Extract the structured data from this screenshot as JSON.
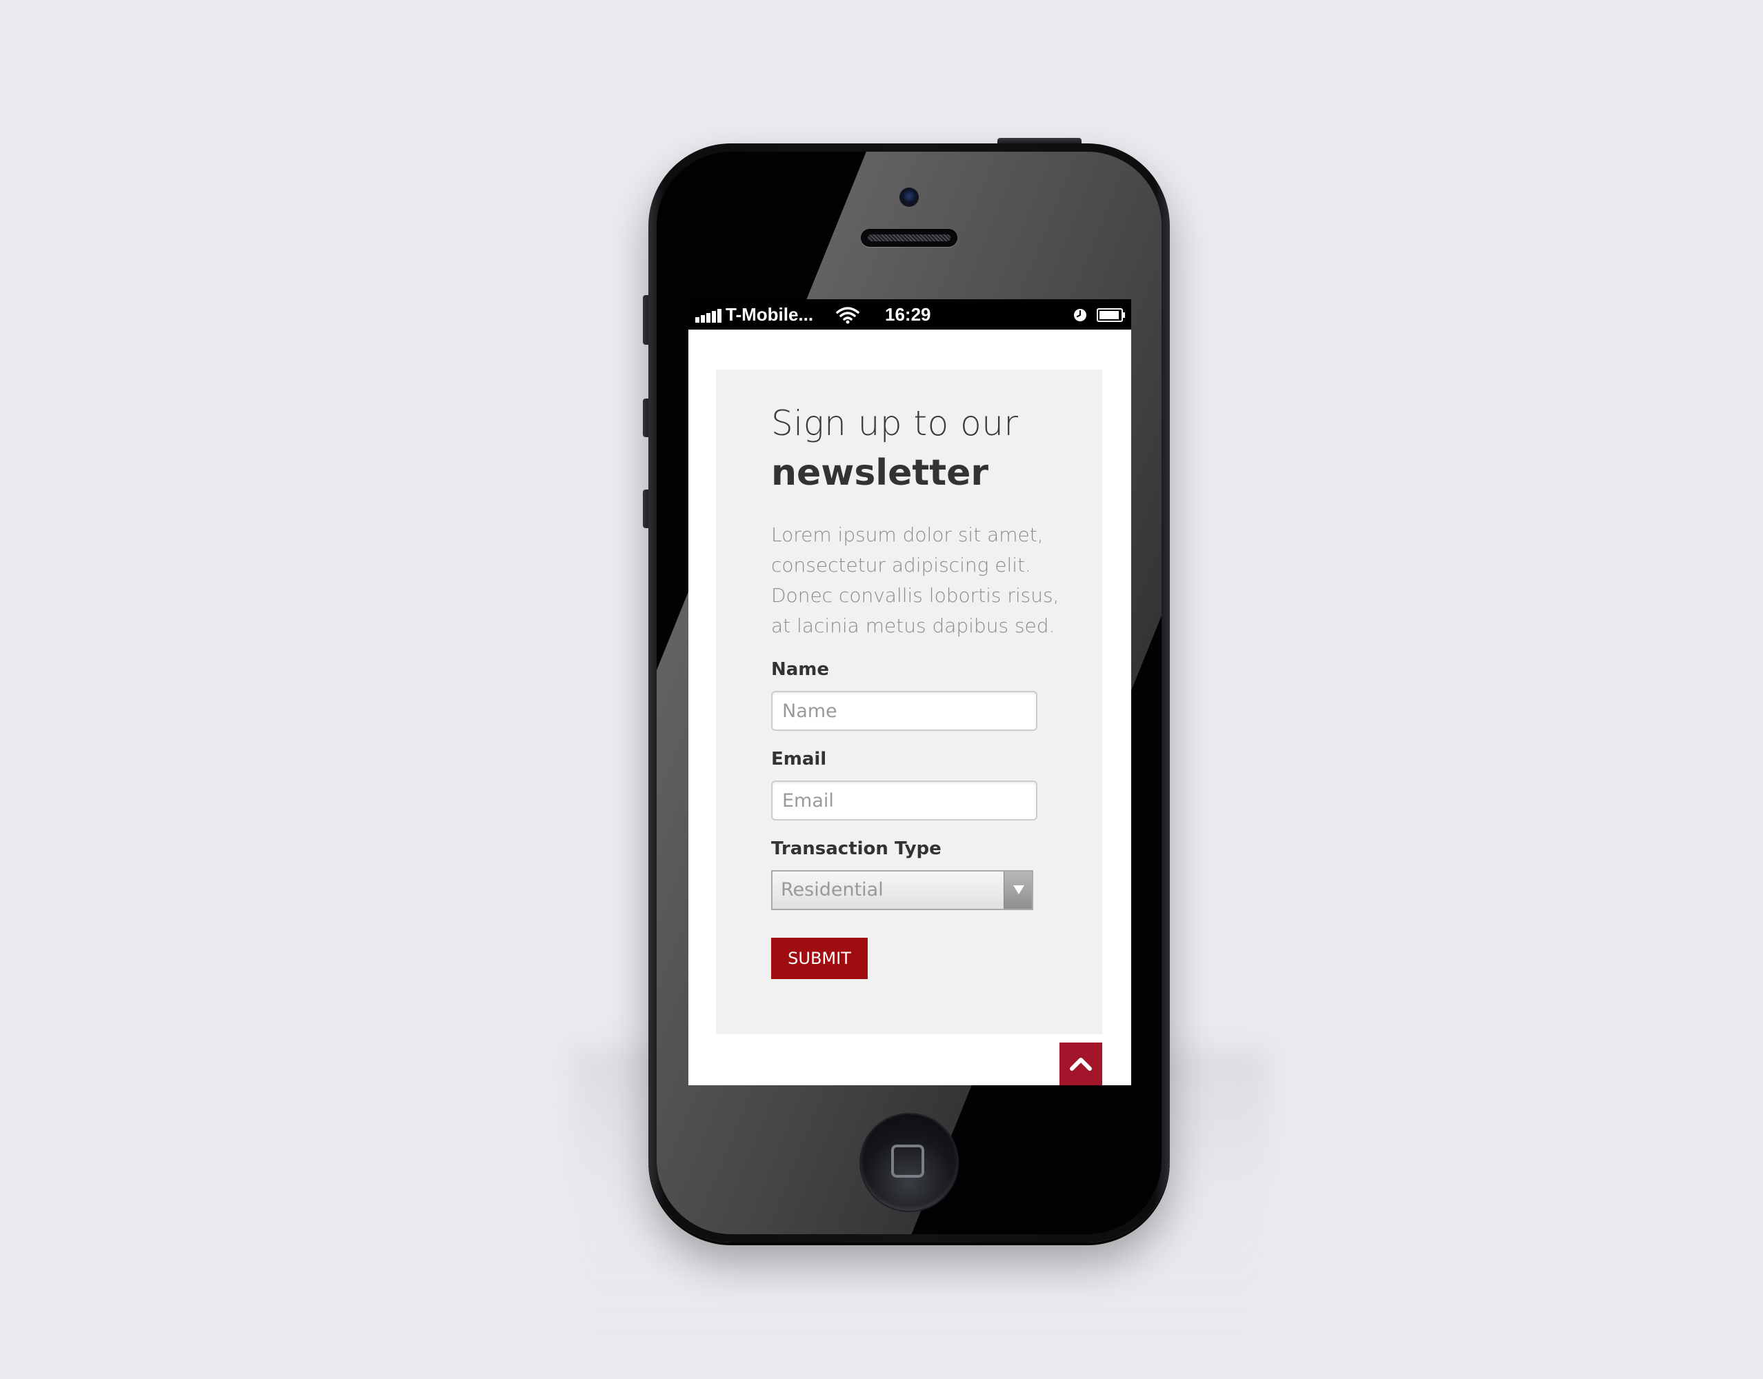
{
  "status_bar": {
    "carrier": "T-Mobile...",
    "time": "16:29"
  },
  "newsletter": {
    "title_light": "Sign up to our",
    "title_bold": "newsletter",
    "description": "Lorem ipsum dolor sit amet, consectetur adipiscing elit. Donec convallis lobortis risus, at lacinia metus dapibus sed.",
    "fields": {
      "name": {
        "label": "Name",
        "placeholder": "Name"
      },
      "email": {
        "label": "Email",
        "placeholder": "Email"
      },
      "transaction_type": {
        "label": "Transaction Type",
        "selected": "Residential"
      }
    },
    "submit_label": "SUBMIT"
  },
  "colors": {
    "submit_bg": "#a00d10",
    "scroll_top_bg": "#a3152b",
    "card_bg": "#f1f1f1",
    "page_bg": "#ebeaee"
  },
  "icons": [
    "signal-icon",
    "wifi-icon",
    "alarm-icon",
    "battery-icon",
    "chevron-up-icon",
    "home-button-icon"
  ]
}
